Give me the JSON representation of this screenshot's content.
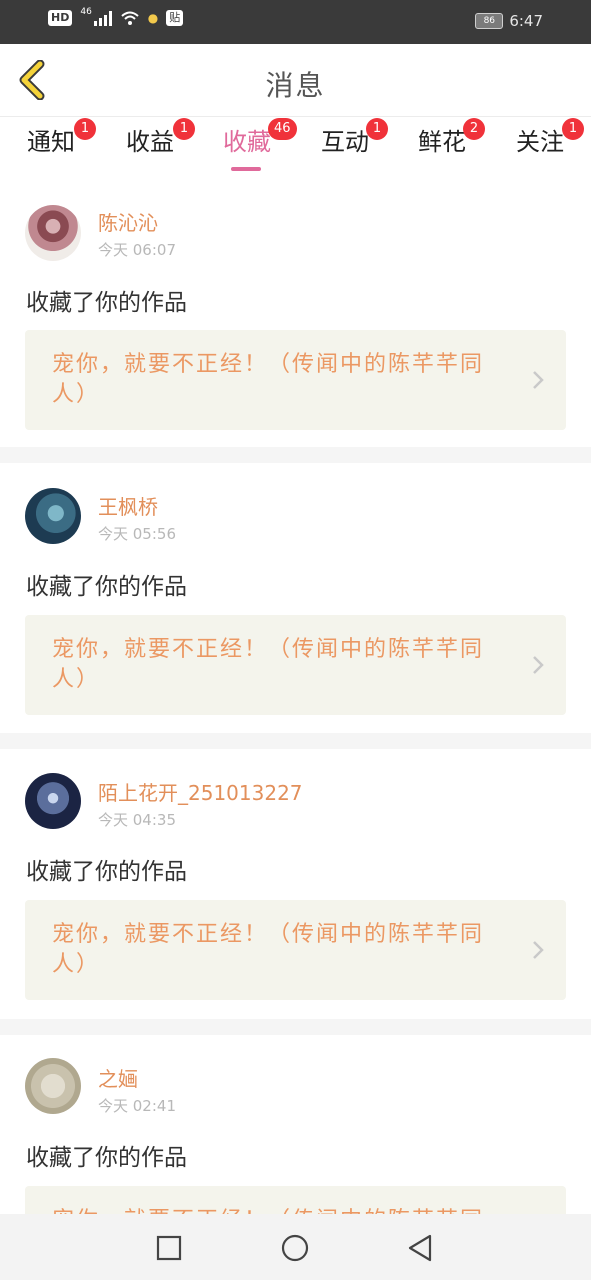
{
  "status_bar": {
    "hd": "HD",
    "network": "46",
    "tie_icon_label": "贴",
    "battery": "86",
    "time": "6:47"
  },
  "header": {
    "title": "消息",
    "back_icon": "chevron-left-icon"
  },
  "tabs": [
    {
      "label": "通知",
      "badge": "1",
      "active": false
    },
    {
      "label": "收益",
      "badge": "1",
      "active": false
    },
    {
      "label": "收藏",
      "badge": "46",
      "active": true
    },
    {
      "label": "互动",
      "badge": "1",
      "active": false
    },
    {
      "label": "鲜花",
      "badge": "2",
      "active": false
    },
    {
      "label": "关注",
      "badge": "1",
      "active": false
    }
  ],
  "colors": {
    "accent": "#e06a9b",
    "badge": "#f0323a",
    "username": "#e28f5a",
    "work_title": "#eb9863",
    "work_box_bg": "#f4f4ec"
  },
  "items": [
    {
      "name": "陈沁沁",
      "time": "今天 06:07",
      "action": "收藏了你的作品",
      "work": "宠你，就要不正经！（传闻中的陈芊芊同人）"
    },
    {
      "name": "王枫桥",
      "time": "今天 05:56",
      "action": "收藏了你的作品",
      "work": "宠你，就要不正经！（传闻中的陈芊芊同人）"
    },
    {
      "name": "陌上花开_251013227",
      "time": "今天 04:35",
      "action": "收藏了你的作品",
      "work": "宠你，就要不正经！（传闻中的陈芊芊同人）"
    },
    {
      "name": "之婳",
      "time": "今天 02:41",
      "action": "收藏了你的作品",
      "work": "宠你，就要不正经！（传闻中的陈芊芊同人）"
    }
  ],
  "nav": {
    "recent": "square-icon",
    "home": "circle-icon",
    "back": "triangle-back-icon"
  }
}
